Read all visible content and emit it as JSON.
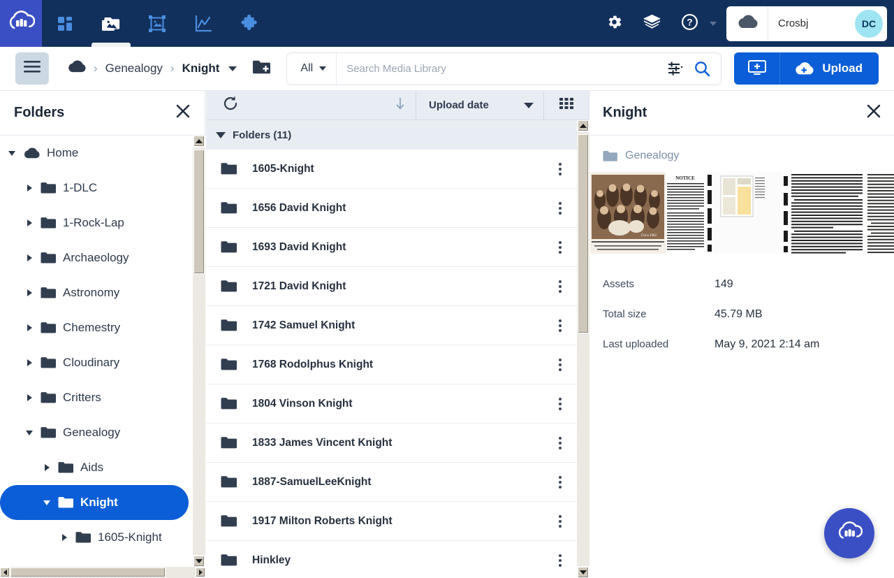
{
  "topnav": {
    "logo_icon": "cloudinary-cloud-logo",
    "tabs": [
      {
        "name": "dashboard",
        "icon": "grid-squares-icon",
        "active": false
      },
      {
        "name": "media-library",
        "icon": "media-library-icon",
        "active": true
      },
      {
        "name": "transformations",
        "icon": "crop-frame-icon",
        "active": false
      },
      {
        "name": "analytics",
        "icon": "line-chart-icon",
        "active": false
      },
      {
        "name": "addons",
        "icon": "puzzle-piece-icon",
        "active": false
      }
    ],
    "settings_icon": "gear-icon",
    "academy_icon": "graduation-cap-icon",
    "help_icon": "question-mark-circle-icon",
    "account_cloud_icon": "cloud-icon",
    "account_name": "Crosbj",
    "avatar_initials": "DC",
    "avatar_color": "#9fe4f2",
    "background_color": "#12305c",
    "logo_tile_color": "#3b4fc4"
  },
  "toolbar": {
    "hamburger_icon": "hamburger-menu-icon",
    "breadcrumb": {
      "home_icon": "cloud-icon",
      "items": [
        {
          "label": "Genealogy",
          "current": false
        },
        {
          "label": "Knight",
          "current": true
        }
      ],
      "dropdown_icon": "chevron-down-icon"
    },
    "new_folder_icon": "new-folder-plus-icon",
    "search": {
      "scope_label": "All",
      "scope_caret_icon": "caret-down-icon",
      "placeholder": "Search Media Library",
      "value": "",
      "filters_icon": "sliders-filter-icon",
      "search_icon": "magnifier-icon"
    },
    "upload_screen_icon": "upload-from-screen-icon",
    "upload_cloud_icon": "cloud-upload-icon",
    "upload_label": "Upload",
    "upload_color": "#0b5ed7"
  },
  "folders_panel": {
    "title": "Folders",
    "close_icon": "close-x-icon",
    "tree": [
      {
        "label": "Home",
        "depth": 0,
        "icon": "cloud-icon",
        "state": "expanded",
        "selected": false
      },
      {
        "label": "1-DLC",
        "depth": 1,
        "icon": "folder-icon",
        "state": "collapsed",
        "selected": false
      },
      {
        "label": "1-Rock-Lap",
        "depth": 1,
        "icon": "folder-icon",
        "state": "collapsed",
        "selected": false
      },
      {
        "label": "Archaeology",
        "depth": 1,
        "icon": "folder-icon",
        "state": "collapsed",
        "selected": false
      },
      {
        "label": "Astronomy",
        "depth": 1,
        "icon": "folder-icon",
        "state": "collapsed",
        "selected": false
      },
      {
        "label": "Chemestry",
        "depth": 1,
        "icon": "folder-icon",
        "state": "collapsed",
        "selected": false
      },
      {
        "label": "Cloudinary",
        "depth": 1,
        "icon": "folder-icon",
        "state": "collapsed",
        "selected": false
      },
      {
        "label": "Critters",
        "depth": 1,
        "icon": "folder-icon",
        "state": "collapsed",
        "selected": false
      },
      {
        "label": "Genealogy",
        "depth": 1,
        "icon": "folder-icon",
        "state": "expanded",
        "selected": false
      },
      {
        "label": "Aids",
        "depth": 2,
        "icon": "folder-icon",
        "state": "collapsed",
        "selected": false
      },
      {
        "label": "Knight",
        "depth": 2,
        "icon": "folder-icon",
        "state": "expanded",
        "selected": true
      },
      {
        "label": "1605-Knight",
        "depth": 3,
        "icon": "folder-icon",
        "state": "collapsed",
        "selected": false
      }
    ],
    "selected_color": "#0b5ed7"
  },
  "file_list": {
    "refresh_icon": "refresh-icon",
    "sort_direction_icon": "arrow-down-icon",
    "sort_by_label": "Upload date",
    "sort_caret_icon": "caret-down-icon",
    "view_mode_icon": "grid-view-icon",
    "group_label": "Folders (11)",
    "group_collapse_icon": "caret-down-icon",
    "rows": [
      {
        "label": "1605-Knight",
        "icon": "folder-icon",
        "menu_icon": "kebab-menu-icon"
      },
      {
        "label": "1656 David Knight",
        "icon": "folder-icon",
        "menu_icon": "kebab-menu-icon"
      },
      {
        "label": "1693 David Knight",
        "icon": "folder-icon",
        "menu_icon": "kebab-menu-icon"
      },
      {
        "label": "1721 David Knight",
        "icon": "folder-icon",
        "menu_icon": "kebab-menu-icon"
      },
      {
        "label": "1742 Samuel Knight",
        "icon": "folder-icon",
        "menu_icon": "kebab-menu-icon"
      },
      {
        "label": "1768 Rodolphus Knight",
        "icon": "folder-icon",
        "menu_icon": "kebab-menu-icon"
      },
      {
        "label": "1804 Vinson Knight",
        "icon": "folder-icon",
        "menu_icon": "kebab-menu-icon"
      },
      {
        "label": "1833 James Vincent Knight",
        "icon": "folder-icon",
        "menu_icon": "kebab-menu-icon"
      },
      {
        "label": "1887-SamuelLeeKnight",
        "icon": "folder-icon",
        "menu_icon": "kebab-menu-icon"
      },
      {
        "label": "1917 Milton Roberts Knight",
        "icon": "folder-icon",
        "menu_icon": "kebab-menu-icon"
      },
      {
        "label": "Hinkley",
        "icon": "folder-icon",
        "menu_icon": "kebab-menu-icon"
      }
    ]
  },
  "details_panel": {
    "title": "Knight",
    "close_icon": "close-x-icon",
    "parent_folder_icon": "folder-icon",
    "parent_folder_label": "Genealogy",
    "thumbnails": [
      {
        "name": "family-portrait-photo"
      },
      {
        "name": "legal-notice-newspaper-clipping"
      },
      {
        "name": "document-scan-thumbnail"
      },
      {
        "name": "newspaper-column-clipping"
      },
      {
        "name": "obituary-newspaper-clipping"
      }
    ],
    "metadata": [
      {
        "key": "Assets",
        "value": "149"
      },
      {
        "key": "Total size",
        "value": "45.79 MB"
      },
      {
        "key": "Last uploaded",
        "value": "May 9, 2021 2:14 am"
      }
    ]
  },
  "fab": {
    "icon": "cloudinary-cloud-logo",
    "color": "#3b4fc4"
  }
}
